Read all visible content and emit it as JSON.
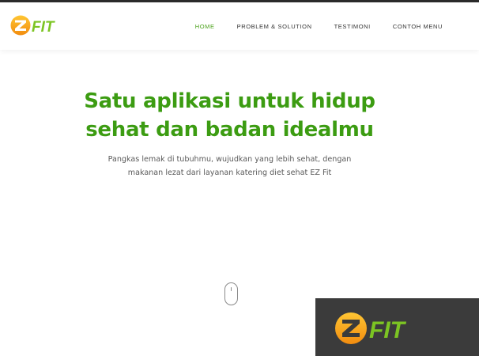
{
  "brand": {
    "logo_text": "FIT",
    "logo_letter": "Z"
  },
  "nav": {
    "items": [
      {
        "label": "HOME",
        "active": true
      },
      {
        "label": "PROBLEM & SOLUTION",
        "active": false
      },
      {
        "label": "TESTIMONI",
        "active": false
      },
      {
        "label": "CONTOH MENU",
        "active": false
      }
    ]
  },
  "hero": {
    "title_line1": "Satu aplikasi untuk hidup",
    "title_line2": "sehat dan badan idealmu",
    "subtitle_line1": "Pangkas lemak di tubuhmu, wujudkan yang lebih sehat, dengan",
    "subtitle_line2": "makanan lezat dari layanan katering diet sehat EZ Fit"
  },
  "colors": {
    "accent": "#3c9c12",
    "nav_active": "#4aa11a",
    "logo_orange": "#f6a21a",
    "logo_green": "#7cc423",
    "overlay_bg": "#3b3b3b"
  },
  "icons": {
    "scroll": "mouse-scroll-icon"
  }
}
